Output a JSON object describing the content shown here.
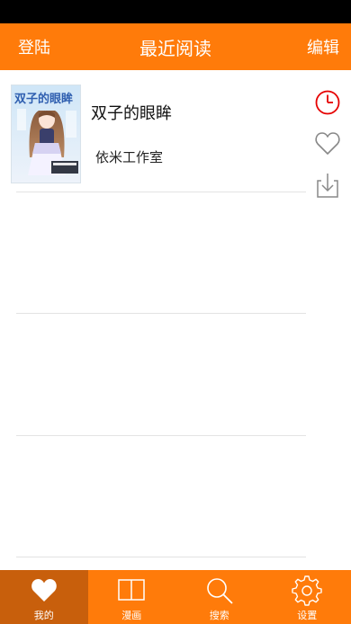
{
  "colors": {
    "accent": "#ff7b0a",
    "tab_active": "#c85f0c",
    "status_bar": "#000000",
    "divider": "#e3e3e3",
    "history_icon": "#e60000",
    "icon_gray": "#888888"
  },
  "header": {
    "login_label": "登陆",
    "title": "最近阅读",
    "edit_label": "编辑"
  },
  "books": [
    {
      "title": "双子的眼眸",
      "author": "依米工作室",
      "cover": {
        "title_text": "双子的眼眸"
      },
      "actions": [
        "history-icon",
        "heart-icon",
        "download-icon"
      ]
    }
  ],
  "tabs": [
    {
      "label": "我的",
      "icon": "heart-icon",
      "active": true
    },
    {
      "label": "漫画",
      "icon": "book-icon",
      "active": false
    },
    {
      "label": "搜索",
      "icon": "search-icon",
      "active": false
    },
    {
      "label": "设置",
      "icon": "gear-icon",
      "active": false
    }
  ]
}
